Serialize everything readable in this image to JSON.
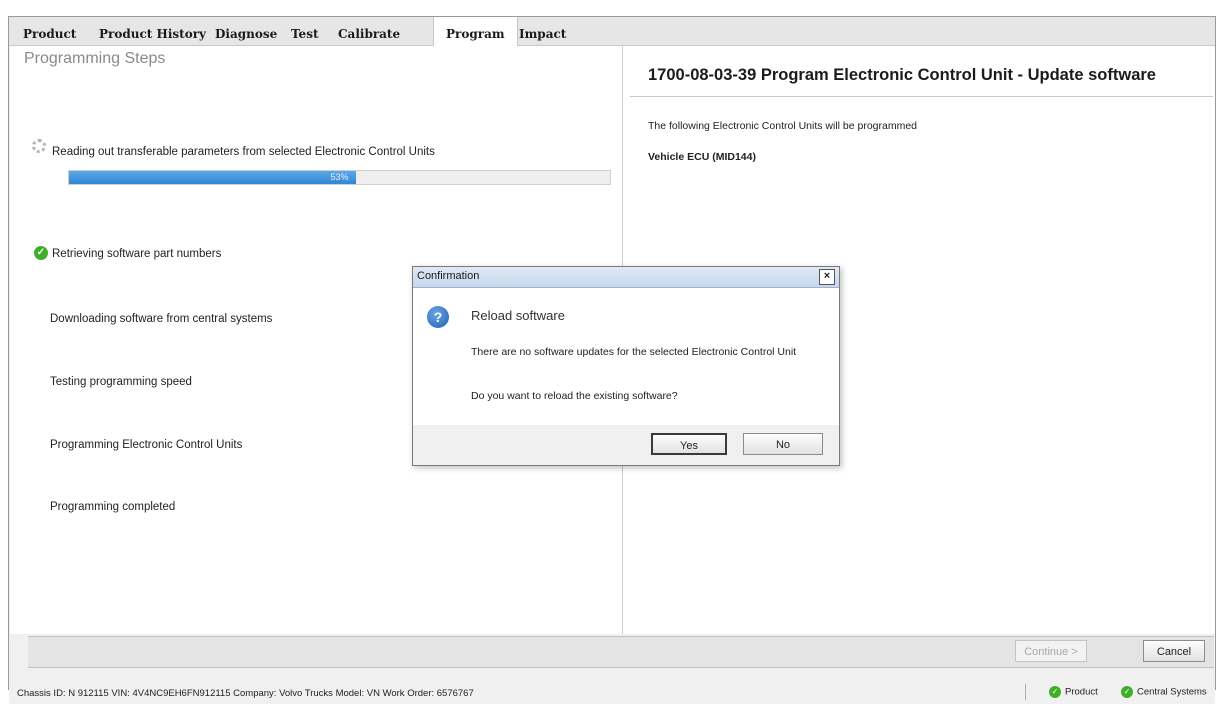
{
  "tabs": [
    {
      "label": "Product",
      "active": false
    },
    {
      "label": "Product History",
      "active": false
    },
    {
      "label": "Diagnose",
      "active": false
    },
    {
      "label": "Test",
      "active": false
    },
    {
      "label": "Calibrate",
      "active": false
    },
    {
      "label": "Program",
      "active": true
    },
    {
      "label": "Impact",
      "active": false
    }
  ],
  "left": {
    "title": "Programming Steps",
    "current_step": "Reading out transferable parameters from selected Electronic Control Units",
    "progress_value": 0.53,
    "progress_label": "53%",
    "steps": [
      "Retrieving software part numbers",
      "Downloading software from central systems",
      "Testing programming speed",
      "Programming Electronic Control Units",
      "Programming completed"
    ]
  },
  "right": {
    "title": "1700-08-03-39 Program Electronic Control Unit - Update software",
    "intro": "The following Electronic Control Units will be programmed",
    "ecu": "Vehicle ECU (MID144)"
  },
  "actions": {
    "continue_label": "Continue >",
    "cancel_label": "Cancel"
  },
  "dialog": {
    "title": "Confirmation",
    "close": "×",
    "heading": "Reload software",
    "message": "There are no software updates for the selected Electronic Control Unit",
    "question": "Do you want to reload the existing software?",
    "yes_label": "Yes",
    "no_label": "No",
    "icon": "question-icon"
  },
  "status": {
    "info": "Chassis ID: N 912115   VIN: 4V4NC9EH6FN912115   Company: Volvo Trucks   Model: VN   Work Order: 6576767",
    "product_label": "Product",
    "central_label": "Central Systems"
  },
  "colors": {
    "progress": "#2e86d6",
    "ok_green": "#3fae2a"
  }
}
